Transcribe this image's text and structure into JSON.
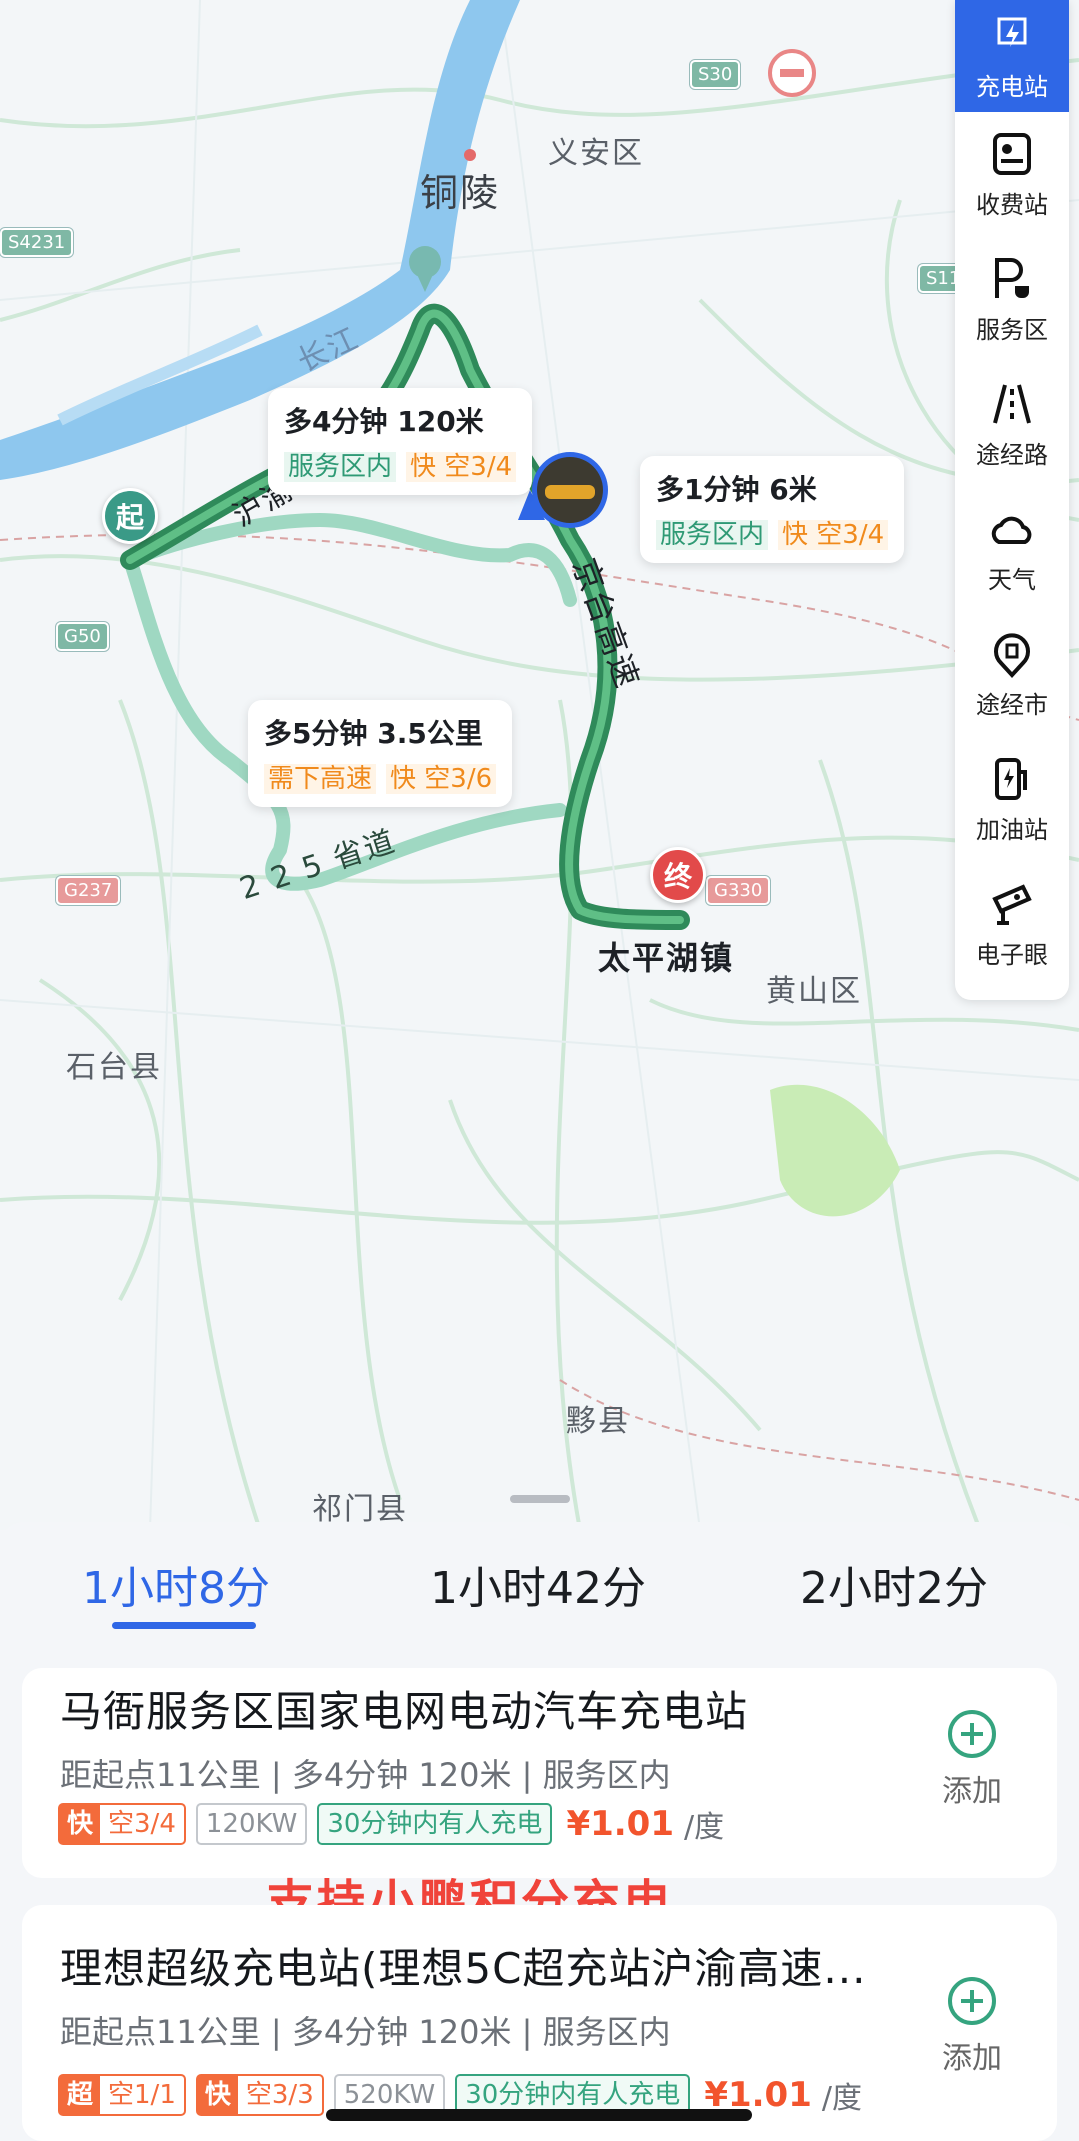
{
  "map": {
    "places": {
      "tongling": "铜陵",
      "yian": "义安区",
      "changjiang": "长江",
      "shitai": "石台县",
      "huangshan": "黄山区",
      "yixian": "黟县",
      "qimen": "祁门县",
      "taipinghu": "太平湖镇",
      "road_225": "2 2 5 省道",
      "jingtai": "京台高速",
      "huyu": "沪渝"
    },
    "shields": {
      "s30": "S30",
      "s4231": "S4231",
      "s11": "S11",
      "g50": "G50",
      "g237": "G237",
      "g330": "G330"
    },
    "start_label": "起",
    "end_label": "终",
    "callouts": [
      {
        "title": "多4分钟 120米",
        "tag1": "服务区内",
        "tag2": "快 空3/4"
      },
      {
        "title": "多1分钟 6米",
        "tag1": "服务区内",
        "tag2": "快 空3/4"
      },
      {
        "title": "多5分钟 3.5公里",
        "tag1": "需下高速",
        "tag2": "快 空3/6"
      }
    ]
  },
  "toolbar": {
    "items": [
      {
        "label": "充电站",
        "icon": "lightning-icon"
      },
      {
        "label": "收费站",
        "icon": "toll-icon"
      },
      {
        "label": "服务区",
        "icon": "service-area-icon"
      },
      {
        "label": "途经路",
        "icon": "road-icon"
      },
      {
        "label": "天气",
        "icon": "cloud-icon"
      },
      {
        "label": "途经市",
        "icon": "city-icon"
      },
      {
        "label": "加油站",
        "icon": "fuel-icon"
      },
      {
        "label": "电子眼",
        "icon": "camera-icon"
      }
    ]
  },
  "routes": {
    "tabs": [
      "1小时8分",
      "1小时42分",
      "2小时2分"
    ]
  },
  "stations": [
    {
      "name": "马衙服务区国家电网电动汽车充电站",
      "detail": "距起点11公里 | 多4分钟 120米 | 服务区内",
      "fast_label": "快",
      "fast_value": "空3/4",
      "power": "120KW",
      "recent": "30分钟内有人充电",
      "price": "¥1.01",
      "unit": "/度",
      "add_label": "添加"
    },
    {
      "name": "理想超级充电站(理想5C超充站沪渝高速...",
      "detail": "距起点11公里 | 多4分钟 120米 | 服务区内",
      "super_label": "超",
      "super_value": "空1/1",
      "fast_label": "快",
      "fast_value": "空3/3",
      "power": "520KW",
      "recent": "30分钟内有人充电",
      "price": "¥1.01",
      "unit": "/度",
      "add_label": "添加"
    }
  ],
  "promo": "支持小鹏积分充电",
  "colors": {
    "accent": "#2f67e6",
    "route": "#2f8a5a",
    "alt_route": "#9fd8c2",
    "river": "#8ec7ee",
    "price": "#f2542d",
    "promo": "#f0433a"
  }
}
